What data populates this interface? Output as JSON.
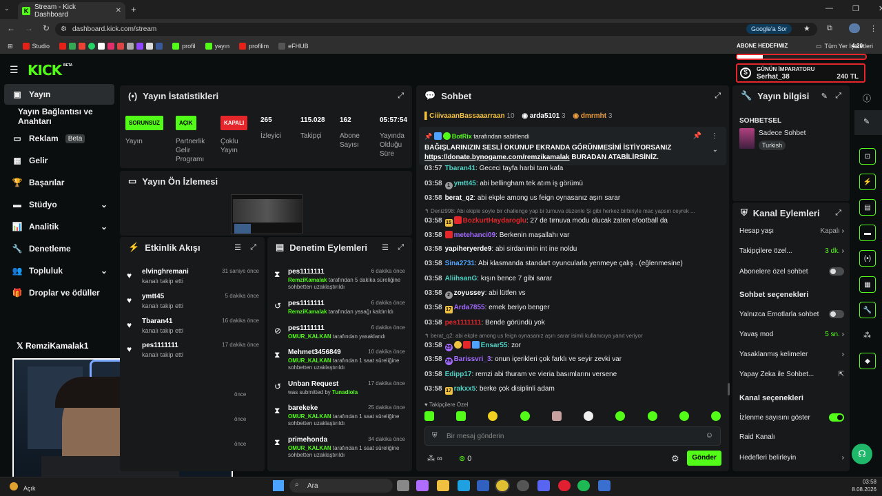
{
  "browser": {
    "tab_title": "Stream - Kick Dashboard",
    "url": "dashboard.kick.com/stream",
    "google_btn": "Google'a Sor",
    "bookmarks": [
      "Studio",
      "profil",
      "yayın",
      "profilim",
      "eFHUB"
    ],
    "all_bookmarks": "Tüm Yer İşaretleri"
  },
  "overlay": {
    "goal_label": "ABONE HEDEFIMIZ",
    "emperor_title": "GÜNÜN İMPARATORU",
    "emperor_name": "Serhat_38",
    "emperor_amount": "240 TL",
    "time": "4:20"
  },
  "brand": {
    "logo": "KICK",
    "beta": "BETA"
  },
  "sidebar": {
    "items": [
      {
        "label": "Yayın"
      },
      {
        "label": "Yayın Bağlantısı ve Anahtarı"
      },
      {
        "label": "Reklam",
        "badge": "Beta"
      },
      {
        "label": "Gelir"
      },
      {
        "label": "Başarılar"
      },
      {
        "label": "Stüdyo"
      },
      {
        "label": "Analitik"
      },
      {
        "label": "Denetleme"
      },
      {
        "label": "Topluluk"
      },
      {
        "label": "Droplar ve ödüller"
      }
    ],
    "social": "RemziKamalak1"
  },
  "stats": {
    "title": "Yayın İstatistikleri",
    "cols": [
      {
        "badge": "SORUNSUZ",
        "label": "Yayın"
      },
      {
        "badge": "AÇIK",
        "label": "Partnerlik Gelir Programı"
      },
      {
        "badge": "KAPALI",
        "label": "Çoklu Yayın"
      },
      {
        "value": "265",
        "label": "İzleyici"
      },
      {
        "value": "115.028",
        "label": "Takipçi"
      },
      {
        "value": "162",
        "label": "Abone Sayısı"
      },
      {
        "value": "05:57:54",
        "label": "Yayında Olduğu Süre"
      }
    ]
  },
  "preview": {
    "title": "Yayın Ön İzlemesi"
  },
  "activity": {
    "title": "Etkinlik Akışı",
    "items": [
      {
        "name": "elvinghremani",
        "sub": "kanalı takip etti",
        "time": "31 saniye önce"
      },
      {
        "name": "ymtt45",
        "sub": "kanalı takip etti",
        "time": "5 dakika önce"
      },
      {
        "name": "Tbaran41",
        "sub": "kanalı takip etti",
        "time": "16 dakika önce"
      },
      {
        "name": "pes1111111",
        "sub": "kanalı takip etti",
        "time": "17 dakika önce"
      }
    ],
    "cut_times": [
      "önce",
      "önce",
      "önce"
    ]
  },
  "moderation": {
    "title": "Denetim Eylemleri",
    "items": [
      {
        "name": "pes1111111",
        "mod": "RemziKamalak",
        "sub": "tarafından 5 dakika süreliğine sohbetten uzaklaştırıldı",
        "time": "6 dakika önce"
      },
      {
        "name": "pes1111111",
        "mod": "RemziKamalak",
        "sub": "tarafından yasağı kaldırıldı",
        "time": "6 dakika önce"
      },
      {
        "name": "pes1111111",
        "mod": "OMUR_KALKAN",
        "sub": "tarafından yasaklandı",
        "time": "6 dakika önce"
      },
      {
        "name": "Mehmet3456849",
        "mod": "OMUR_KALKAN",
        "sub": "tarafından 1 saat süreliğine sohbetten uzaklaştırıldı",
        "time": "10 dakika önce"
      },
      {
        "name": "Unban Request",
        "mod": "Tunadiola",
        "pre": "was submitted by",
        "sub": "",
        "time": "17 dakika önce"
      },
      {
        "name": "barekeke",
        "mod": "OMUR_KALKAN",
        "sub": "tarafından 1 saat süreliğine sohbetten uzaklaştırıldı",
        "time": "25 dakika önce"
      },
      {
        "name": "primehonda",
        "mod": "OMUR_KALKAN",
        "sub": "tarafından 1 saat süreliğine sohbetten uzaklaştırıldı",
        "time": "34 dakika önce"
      }
    ]
  },
  "chat": {
    "title": "Sohbet",
    "top": [
      {
        "name": "CiiivaaanBassaaarraan",
        "n": "10"
      },
      {
        "name": "arda5101",
        "n": "3"
      },
      {
        "name": "dmrmht",
        "n": "3"
      }
    ],
    "pinned": {
      "by": "BotRix",
      "by_suffix": "tarafından sabitlendi",
      "text": "BAĞIŞLARINIZIN SESLİ OKUNUP EKRANDA GÖRÜNMESİNİ İSTİYORSANIZ",
      "link": "https://donate.bynogame.com/remzikamalak",
      "text2": "BURADAN ATABİLİRSİNİZ."
    },
    "messages": [
      {
        "ts": "03:57",
        "user": "Tbaran41",
        "color": "#4fd1c5",
        "text": "Gececi tayfa harbi tam kafa"
      },
      {
        "ts": "03:58",
        "user": "ymtt45",
        "color": "#4fd1c5",
        "text": "abi bellingham tek atım iş görümü",
        "badge": "1"
      },
      {
        "ts": "03:58",
        "user": "berat_q2",
        "color": "#ffffff",
        "text": "abi ekple among us feign oynasanız aşırı sarar"
      },
      {
        "reply": "Deniz998: Abi ekiple soyle bir challenge yap bi turnuva düzenle Şi gibi herkez birbiriyle mac yapsın ceyrek ..."
      },
      {
        "ts": "03:58",
        "user": "BozkurtHaydaroglu",
        "color": "#e5262a",
        "text": "27 de tırnuva modu olucak zaten efootball da",
        "badge": "15"
      },
      {
        "ts": "03:58",
        "user": "metehanci09",
        "color": "#a36bff",
        "text": "Berkenin maşallahı var"
      },
      {
        "ts": "03:58",
        "user": "yapiheryerde9",
        "color": "#ffffff",
        "text": "abi sirdanimin int ine noldu"
      },
      {
        "ts": "03:58",
        "user": "Sina2731",
        "color": "#4fa3ff",
        "text": "Abi klasmanda standart oyuncularla yenmeye çalış . (eğlenmesine)"
      },
      {
        "ts": "03:58",
        "user": "AliihsanG",
        "color": "#4fd1c5",
        "text": "kışın bence 7 gibi sarar"
      },
      {
        "ts": "03:58",
        "user": "zoyussey",
        "color": "#ffffff",
        "text": "abi lütfen vs",
        "badge": "2"
      },
      {
        "ts": "03:58",
        "user": "Arda7855",
        "color": "#a36bff",
        "text": "emek beriyo benger",
        "badge": "17"
      },
      {
        "ts": "03:58",
        "user": "pes1111111",
        "color": "#e5262a",
        "text": "Bende göründü yok"
      },
      {
        "reply": "berat_q2: abi ekple among us feign oynasanız aşırı sarar isimli kullanıcıya yanıt veriyor"
      },
      {
        "ts": "03:58",
        "user": "Ensar55",
        "color": "#4fd1c5",
        "text": "zor",
        "badge": "29"
      },
      {
        "ts": "03:58",
        "user": "Barissvri_3",
        "color": "#a36bff",
        "text": "onun içerikleri çok farklı ve seyir zevki var",
        "badge": "29"
      },
      {
        "ts": "03:58",
        "user": "Edipp17",
        "color": "#4fd1c5",
        "text": "remzi abi thuram ve vieria basımlarını versene"
      },
      {
        "ts": "03:58",
        "user": "rakxx5",
        "color": "#4fd1c5",
        "text": "berke çok disiplinli adam",
        "badge": "17"
      }
    ],
    "followers_only": "Takipçilere Özel",
    "input_placeholder": "Bir mesaj gönderin",
    "count": "0",
    "send": "Gönder"
  },
  "info": {
    "title": "Yayın bilgisi",
    "category": "SOHBETSEL",
    "stream_title": "Sadece Sohbet",
    "tag": "Turkish"
  },
  "channel": {
    "title": "Kanal Eylemleri",
    "rows": [
      {
        "label": "Hesap yaşı",
        "value": "Kapalı"
      },
      {
        "label": "Takipçilere özel...",
        "value": "3 dk."
      },
      {
        "label": "Abonelere özel sohbet",
        "toggle": false
      }
    ],
    "chat_opts_title": "Sohbet seçenekleri",
    "chat_opts": [
      {
        "label": "Yalnızca Emotlarla sohbet",
        "toggle": false
      },
      {
        "label": "Yavaş mod",
        "value": "5 sn."
      },
      {
        "label": "Yasaklanmış kelimeler"
      },
      {
        "label": "Yapay Zeka ile Sohbet..."
      }
    ],
    "channel_opts_title": "Kanal seçenekleri",
    "channel_opts": [
      {
        "label": "İzlenme sayısını göster",
        "toggle": true
      },
      {
        "label": "Raid Kanalı"
      },
      {
        "label": "Hedefleri belirleyin"
      }
    ]
  },
  "taskbar": {
    "weather": "Açık",
    "search": "Ara",
    "time": "03:58",
    "date": "8.08.2026"
  }
}
